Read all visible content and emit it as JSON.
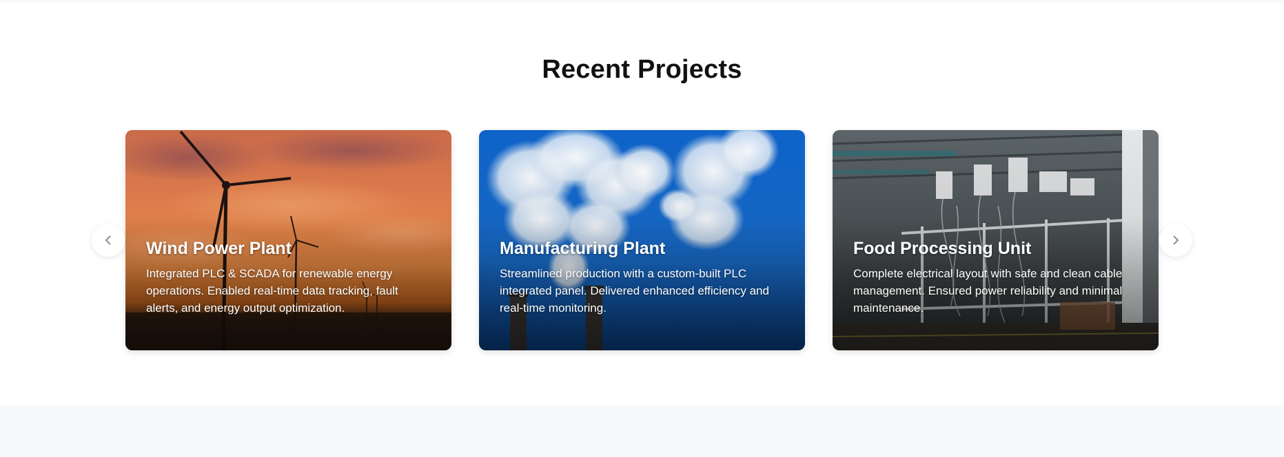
{
  "section": {
    "title": "Recent Projects"
  },
  "carousel": {
    "prev_icon": "chevron-left-icon",
    "next_icon": "chevron-right-icon",
    "cards": [
      {
        "title": "Wind Power Plant",
        "description": "Integrated PLC & SCADA for renewable energy operations. Enabled real-time data tracking, fault alerts, and energy output optimization.",
        "image": "wind-turbines-sunset-image"
      },
      {
        "title": "Manufacturing Plant",
        "description": "Streamlined production with a custom-built PLC integrated panel. Delivered enhanced efficiency and real-time monitoring.",
        "image": "factory-smokestacks-clouds-image"
      },
      {
        "title": "Food Processing Unit",
        "description": "Complete electrical layout with safe and clean cable management. Ensured power reliability and minimal maintenance.",
        "image": "industrial-machinery-interior-image"
      }
    ]
  },
  "colors": {
    "title": "#111111",
    "card_text": "#ffffff",
    "page_bg": "#ffffff",
    "band_bg": "#f8f9fb",
    "chevron": "#8a8f98"
  }
}
